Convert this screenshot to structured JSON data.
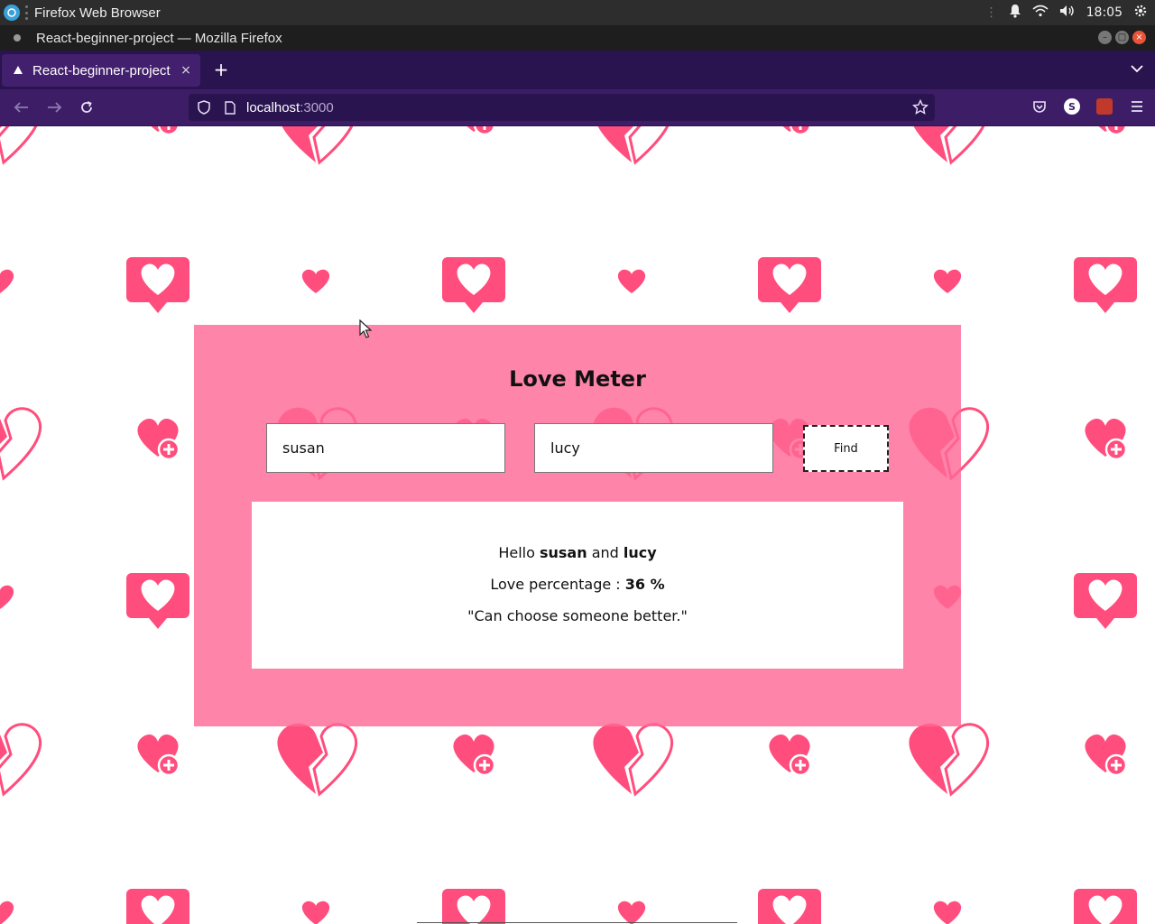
{
  "os": {
    "app_title": "Firefox Web Browser",
    "clock": "18:05"
  },
  "window": {
    "title": "React-beginner-project — Mozilla Firefox"
  },
  "tabs": [
    {
      "label": "React-beginner-project",
      "close": "×"
    }
  ],
  "new_tab_label": "+",
  "urlbar": {
    "host": "localhost",
    "port": ":3000"
  },
  "nav": {
    "account_initial": "S"
  },
  "colors": {
    "accent_pink": "#ff4d7d",
    "card_pink": "#ff86a5",
    "tab_strip": "#2a1450",
    "nav_bar": "#3d1e66"
  },
  "app": {
    "title": "Love Meter",
    "name1_value": "susan",
    "name2_value": "lucy",
    "find_label": "Find",
    "result": {
      "hello": "Hello",
      "and": "and",
      "name1": "susan",
      "name2": "lucy",
      "percentage_label": "Love percentage :",
      "percentage_value": "36 %",
      "message": "\"Can choose someone better.\""
    }
  },
  "icons": {
    "background_pattern": [
      "heart-plus-icon",
      "broken-heart-icon",
      "heart-speech-bubble-icon",
      "small-heart-icon"
    ]
  }
}
